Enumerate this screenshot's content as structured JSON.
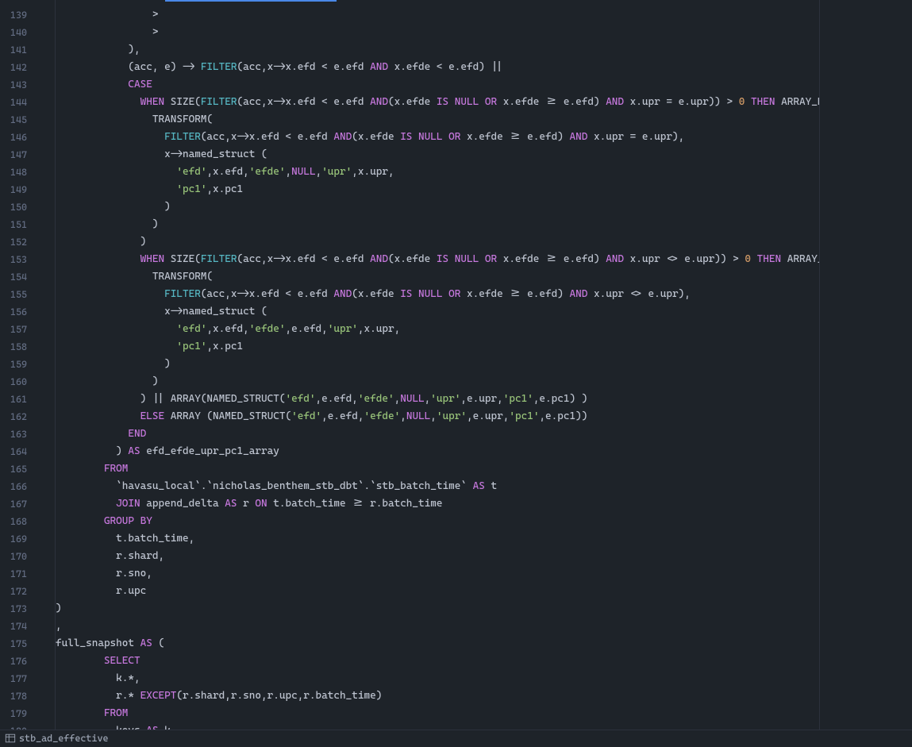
{
  "line_start": 139,
  "line_end": 180,
  "status_text": "stb_ad_effective",
  "code_lines": [
    {
      "n": 139,
      "indent": 8,
      "tokens": [
        {
          "t": ">",
          "c": "c-p"
        }
      ]
    },
    {
      "n": 140,
      "indent": 8,
      "tokens": [
        {
          "t": ">",
          "c": "c-p"
        }
      ]
    },
    {
      "n": 141,
      "indent": 6,
      "tokens": [
        {
          "t": "),",
          "c": "c-p"
        }
      ]
    },
    {
      "n": 142,
      "indent": 6,
      "tokens": [
        {
          "t": "(acc, e) -> ",
          "c": "c-p"
        },
        {
          "t": "FILTER",
          "c": "c-fn"
        },
        {
          "t": "(acc,x->x.efd < e.efd ",
          "c": "c-p"
        },
        {
          "t": "AND",
          "c": "c-kw"
        },
        {
          "t": " x.efde < e.efd) ||",
          "c": "c-p"
        }
      ]
    },
    {
      "n": 143,
      "indent": 6,
      "tokens": [
        {
          "t": "CASE",
          "c": "c-kw"
        }
      ]
    },
    {
      "n": 144,
      "indent": 7,
      "tokens": [
        {
          "t": "WHEN",
          "c": "c-kw"
        },
        {
          "t": " SIZE(",
          "c": "c-p"
        },
        {
          "t": "FILTER",
          "c": "c-fn"
        },
        {
          "t": "(acc,x->x.efd < e.efd ",
          "c": "c-p"
        },
        {
          "t": "AND",
          "c": "c-kw"
        },
        {
          "t": "(x.efde ",
          "c": "c-p"
        },
        {
          "t": "IS",
          "c": "c-kw"
        },
        {
          "t": " ",
          "c": "c-p"
        },
        {
          "t": "NULL",
          "c": "c-kw"
        },
        {
          "t": " ",
          "c": "c-p"
        },
        {
          "t": "OR",
          "c": "c-kw"
        },
        {
          "t": " x.efde >= e.efd) ",
          "c": "c-p"
        },
        {
          "t": "AND",
          "c": "c-kw"
        },
        {
          "t": " x.upr = e.upr)) > ",
          "c": "c-p"
        },
        {
          "t": "0",
          "c": "c-nm"
        },
        {
          "t": " ",
          "c": "c-p"
        },
        {
          "t": "THEN",
          "c": "c-kw"
        },
        {
          "t": " ARRAY_DISTINCT(",
          "c": "c-p"
        }
      ]
    },
    {
      "n": 145,
      "indent": 8,
      "tokens": [
        {
          "t": "TRANSFORM(",
          "c": "c-p"
        }
      ]
    },
    {
      "n": 146,
      "indent": 9,
      "tokens": [
        {
          "t": "FILTER",
          "c": "c-fn"
        },
        {
          "t": "(acc,x->x.efd < e.efd ",
          "c": "c-p"
        },
        {
          "t": "AND",
          "c": "c-kw"
        },
        {
          "t": "(x.efde ",
          "c": "c-p"
        },
        {
          "t": "IS",
          "c": "c-kw"
        },
        {
          "t": " ",
          "c": "c-p"
        },
        {
          "t": "NULL",
          "c": "c-kw"
        },
        {
          "t": " ",
          "c": "c-p"
        },
        {
          "t": "OR",
          "c": "c-kw"
        },
        {
          "t": " x.efde >= e.efd) ",
          "c": "c-p"
        },
        {
          "t": "AND",
          "c": "c-kw"
        },
        {
          "t": " x.upr = e.upr),",
          "c": "c-p"
        }
      ]
    },
    {
      "n": 147,
      "indent": 9,
      "tokens": [
        {
          "t": "x->named_struct (",
          "c": "c-p"
        }
      ]
    },
    {
      "n": 148,
      "indent": 10,
      "tokens": [
        {
          "t": "'efd'",
          "c": "c-st"
        },
        {
          "t": ",x.efd,",
          "c": "c-p"
        },
        {
          "t": "'efde'",
          "c": "c-st"
        },
        {
          "t": ",",
          "c": "c-p"
        },
        {
          "t": "NULL",
          "c": "c-kw"
        },
        {
          "t": ",",
          "c": "c-p"
        },
        {
          "t": "'upr'",
          "c": "c-st"
        },
        {
          "t": ",x.upr,",
          "c": "c-p"
        }
      ]
    },
    {
      "n": 149,
      "indent": 10,
      "tokens": [
        {
          "t": "'pc1'",
          "c": "c-st"
        },
        {
          "t": ",x.pc1",
          "c": "c-p"
        }
      ]
    },
    {
      "n": 150,
      "indent": 9,
      "tokens": [
        {
          "t": ")",
          "c": "c-p"
        }
      ]
    },
    {
      "n": 151,
      "indent": 8,
      "tokens": [
        {
          "t": ")",
          "c": "c-p"
        }
      ]
    },
    {
      "n": 152,
      "indent": 7,
      "tokens": [
        {
          "t": ")",
          "c": "c-p"
        }
      ]
    },
    {
      "n": 153,
      "indent": 7,
      "tokens": [
        {
          "t": "WHEN",
          "c": "c-kw"
        },
        {
          "t": " SIZE(",
          "c": "c-p"
        },
        {
          "t": "FILTER",
          "c": "c-fn"
        },
        {
          "t": "(acc,x->x.efd < e.efd ",
          "c": "c-p"
        },
        {
          "t": "AND",
          "c": "c-kw"
        },
        {
          "t": "(x.efde ",
          "c": "c-p"
        },
        {
          "t": "IS",
          "c": "c-kw"
        },
        {
          "t": " ",
          "c": "c-p"
        },
        {
          "t": "NULL",
          "c": "c-kw"
        },
        {
          "t": " ",
          "c": "c-p"
        },
        {
          "t": "OR",
          "c": "c-kw"
        },
        {
          "t": " x.efde >= e.efd) ",
          "c": "c-p"
        },
        {
          "t": "AND",
          "c": "c-kw"
        },
        {
          "t": " x.upr <> e.upr)) > ",
          "c": "c-p"
        },
        {
          "t": "0",
          "c": "c-nm"
        },
        {
          "t": " ",
          "c": "c-p"
        },
        {
          "t": "THEN",
          "c": "c-kw"
        },
        {
          "t": " ARRAY_DISTINCT(",
          "c": "c-p"
        }
      ]
    },
    {
      "n": 154,
      "indent": 8,
      "tokens": [
        {
          "t": "TRANSFORM(",
          "c": "c-p"
        }
      ]
    },
    {
      "n": 155,
      "indent": 9,
      "tokens": [
        {
          "t": "FILTER",
          "c": "c-fn"
        },
        {
          "t": "(acc,x->x.efd < e.efd ",
          "c": "c-p"
        },
        {
          "t": "AND",
          "c": "c-kw"
        },
        {
          "t": "(x.efde ",
          "c": "c-p"
        },
        {
          "t": "IS",
          "c": "c-kw"
        },
        {
          "t": " ",
          "c": "c-p"
        },
        {
          "t": "NULL",
          "c": "c-kw"
        },
        {
          "t": " ",
          "c": "c-p"
        },
        {
          "t": "OR",
          "c": "c-kw"
        },
        {
          "t": " x.efde >= e.efd) ",
          "c": "c-p"
        },
        {
          "t": "AND",
          "c": "c-kw"
        },
        {
          "t": " x.upr <> e.upr),",
          "c": "c-p"
        }
      ]
    },
    {
      "n": 156,
      "indent": 9,
      "tokens": [
        {
          "t": "x->named_struct (",
          "c": "c-p"
        }
      ]
    },
    {
      "n": 157,
      "indent": 10,
      "tokens": [
        {
          "t": "'efd'",
          "c": "c-st"
        },
        {
          "t": ",x.efd,",
          "c": "c-p"
        },
        {
          "t": "'efde'",
          "c": "c-st"
        },
        {
          "t": ",e.efd,",
          "c": "c-p"
        },
        {
          "t": "'upr'",
          "c": "c-st"
        },
        {
          "t": ",x.upr,",
          "c": "c-p"
        }
      ]
    },
    {
      "n": 158,
      "indent": 10,
      "tokens": [
        {
          "t": "'pc1'",
          "c": "c-st"
        },
        {
          "t": ",x.pc1",
          "c": "c-p"
        }
      ]
    },
    {
      "n": 159,
      "indent": 9,
      "tokens": [
        {
          "t": ")",
          "c": "c-p"
        }
      ]
    },
    {
      "n": 160,
      "indent": 8,
      "tokens": [
        {
          "t": ")",
          "c": "c-p"
        }
      ]
    },
    {
      "n": 161,
      "indent": 7,
      "tokens": [
        {
          "t": ") || ARRAY(NAMED_STRUCT(",
          "c": "c-p"
        },
        {
          "t": "'efd'",
          "c": "c-st"
        },
        {
          "t": ",e.efd,",
          "c": "c-p"
        },
        {
          "t": "'efde'",
          "c": "c-st"
        },
        {
          "t": ",",
          "c": "c-p"
        },
        {
          "t": "NULL",
          "c": "c-kw"
        },
        {
          "t": ",",
          "c": "c-p"
        },
        {
          "t": "'upr'",
          "c": "c-st"
        },
        {
          "t": ",e.upr,",
          "c": "c-p"
        },
        {
          "t": "'pc1'",
          "c": "c-st"
        },
        {
          "t": ",e.pc1) )",
          "c": "c-p"
        }
      ]
    },
    {
      "n": 162,
      "indent": 7,
      "tokens": [
        {
          "t": "ELSE",
          "c": "c-kw"
        },
        {
          "t": " ARRAY (NAMED_STRUCT(",
          "c": "c-p"
        },
        {
          "t": "'efd'",
          "c": "c-st"
        },
        {
          "t": ",e.efd,",
          "c": "c-p"
        },
        {
          "t": "'efde'",
          "c": "c-st"
        },
        {
          "t": ",",
          "c": "c-p"
        },
        {
          "t": "NULL",
          "c": "c-kw"
        },
        {
          "t": ",",
          "c": "c-p"
        },
        {
          "t": "'upr'",
          "c": "c-st"
        },
        {
          "t": ",e.upr,",
          "c": "c-p"
        },
        {
          "t": "'pc1'",
          "c": "c-st"
        },
        {
          "t": ",e.pc1))",
          "c": "c-p"
        }
      ]
    },
    {
      "n": 163,
      "indent": 6,
      "tokens": [
        {
          "t": "END",
          "c": "c-kw"
        }
      ]
    },
    {
      "n": 164,
      "indent": 5,
      "tokens": [
        {
          "t": ") ",
          "c": "c-p"
        },
        {
          "t": "AS",
          "c": "c-kw"
        },
        {
          "t": " efd_efde_upr_pc1_array",
          "c": "c-p"
        }
      ]
    },
    {
      "n": 165,
      "indent": 4,
      "tokens": [
        {
          "t": "FROM",
          "c": "c-kw"
        }
      ]
    },
    {
      "n": 166,
      "indent": 5,
      "tokens": [
        {
          "t": "`havasu_local`.`nicholas_benthem_stb_dbt`.`stb_batch_time` ",
          "c": "c-p"
        },
        {
          "t": "AS",
          "c": "c-kw"
        },
        {
          "t": " t",
          "c": "c-p"
        }
      ]
    },
    {
      "n": 167,
      "indent": 5,
      "tokens": [
        {
          "t": "JOIN",
          "c": "c-kw"
        },
        {
          "t": " append_delta ",
          "c": "c-p"
        },
        {
          "t": "AS",
          "c": "c-kw"
        },
        {
          "t": " r ",
          "c": "c-p"
        },
        {
          "t": "ON",
          "c": "c-kw"
        },
        {
          "t": " t.batch_time >= r.batch_time",
          "c": "c-p"
        }
      ]
    },
    {
      "n": 168,
      "indent": 4,
      "tokens": [
        {
          "t": "GROUP BY",
          "c": "c-kw"
        }
      ]
    },
    {
      "n": 169,
      "indent": 5,
      "tokens": [
        {
          "t": "t.batch_time,",
          "c": "c-p"
        }
      ]
    },
    {
      "n": 170,
      "indent": 5,
      "tokens": [
        {
          "t": "r.shard,",
          "c": "c-p"
        }
      ]
    },
    {
      "n": 171,
      "indent": 5,
      "tokens": [
        {
          "t": "r.sno,",
          "c": "c-p"
        }
      ]
    },
    {
      "n": 172,
      "indent": 5,
      "tokens": [
        {
          "t": "r.upc",
          "c": "c-p"
        }
      ]
    },
    {
      "n": 173,
      "indent": 0,
      "tokens": [
        {
          "t": ")",
          "c": "c-p"
        }
      ]
    },
    {
      "n": 174,
      "indent": 0,
      "tokens": [
        {
          "t": ",",
          "c": "c-p"
        }
      ]
    },
    {
      "n": 175,
      "indent": 0,
      "tokens": [
        {
          "t": "full_snapshot ",
          "c": "c-p"
        },
        {
          "t": "AS",
          "c": "c-kw"
        },
        {
          "t": " (",
          "c": "c-p"
        }
      ]
    },
    {
      "n": 176,
      "indent": 4,
      "tokens": [
        {
          "t": "SELECT",
          "c": "c-kw"
        }
      ]
    },
    {
      "n": 177,
      "indent": 5,
      "tokens": [
        {
          "t": "k.*,",
          "c": "c-p"
        }
      ]
    },
    {
      "n": 178,
      "indent": 5,
      "tokens": [
        {
          "t": "r.* ",
          "c": "c-p"
        },
        {
          "t": "EXCEPT",
          "c": "c-kw"
        },
        {
          "t": "(r.shard,r.sno,r.upc,r.batch_time)",
          "c": "c-p"
        }
      ]
    },
    {
      "n": 179,
      "indent": 4,
      "tokens": [
        {
          "t": "FROM",
          "c": "c-kw"
        }
      ]
    },
    {
      "n": 180,
      "indent": 5,
      "tokens": [
        {
          "t": "keys ",
          "c": "c-p"
        },
        {
          "t": "AS",
          "c": "c-kw"
        },
        {
          "t": " k",
          "c": "c-p"
        }
      ]
    }
  ]
}
